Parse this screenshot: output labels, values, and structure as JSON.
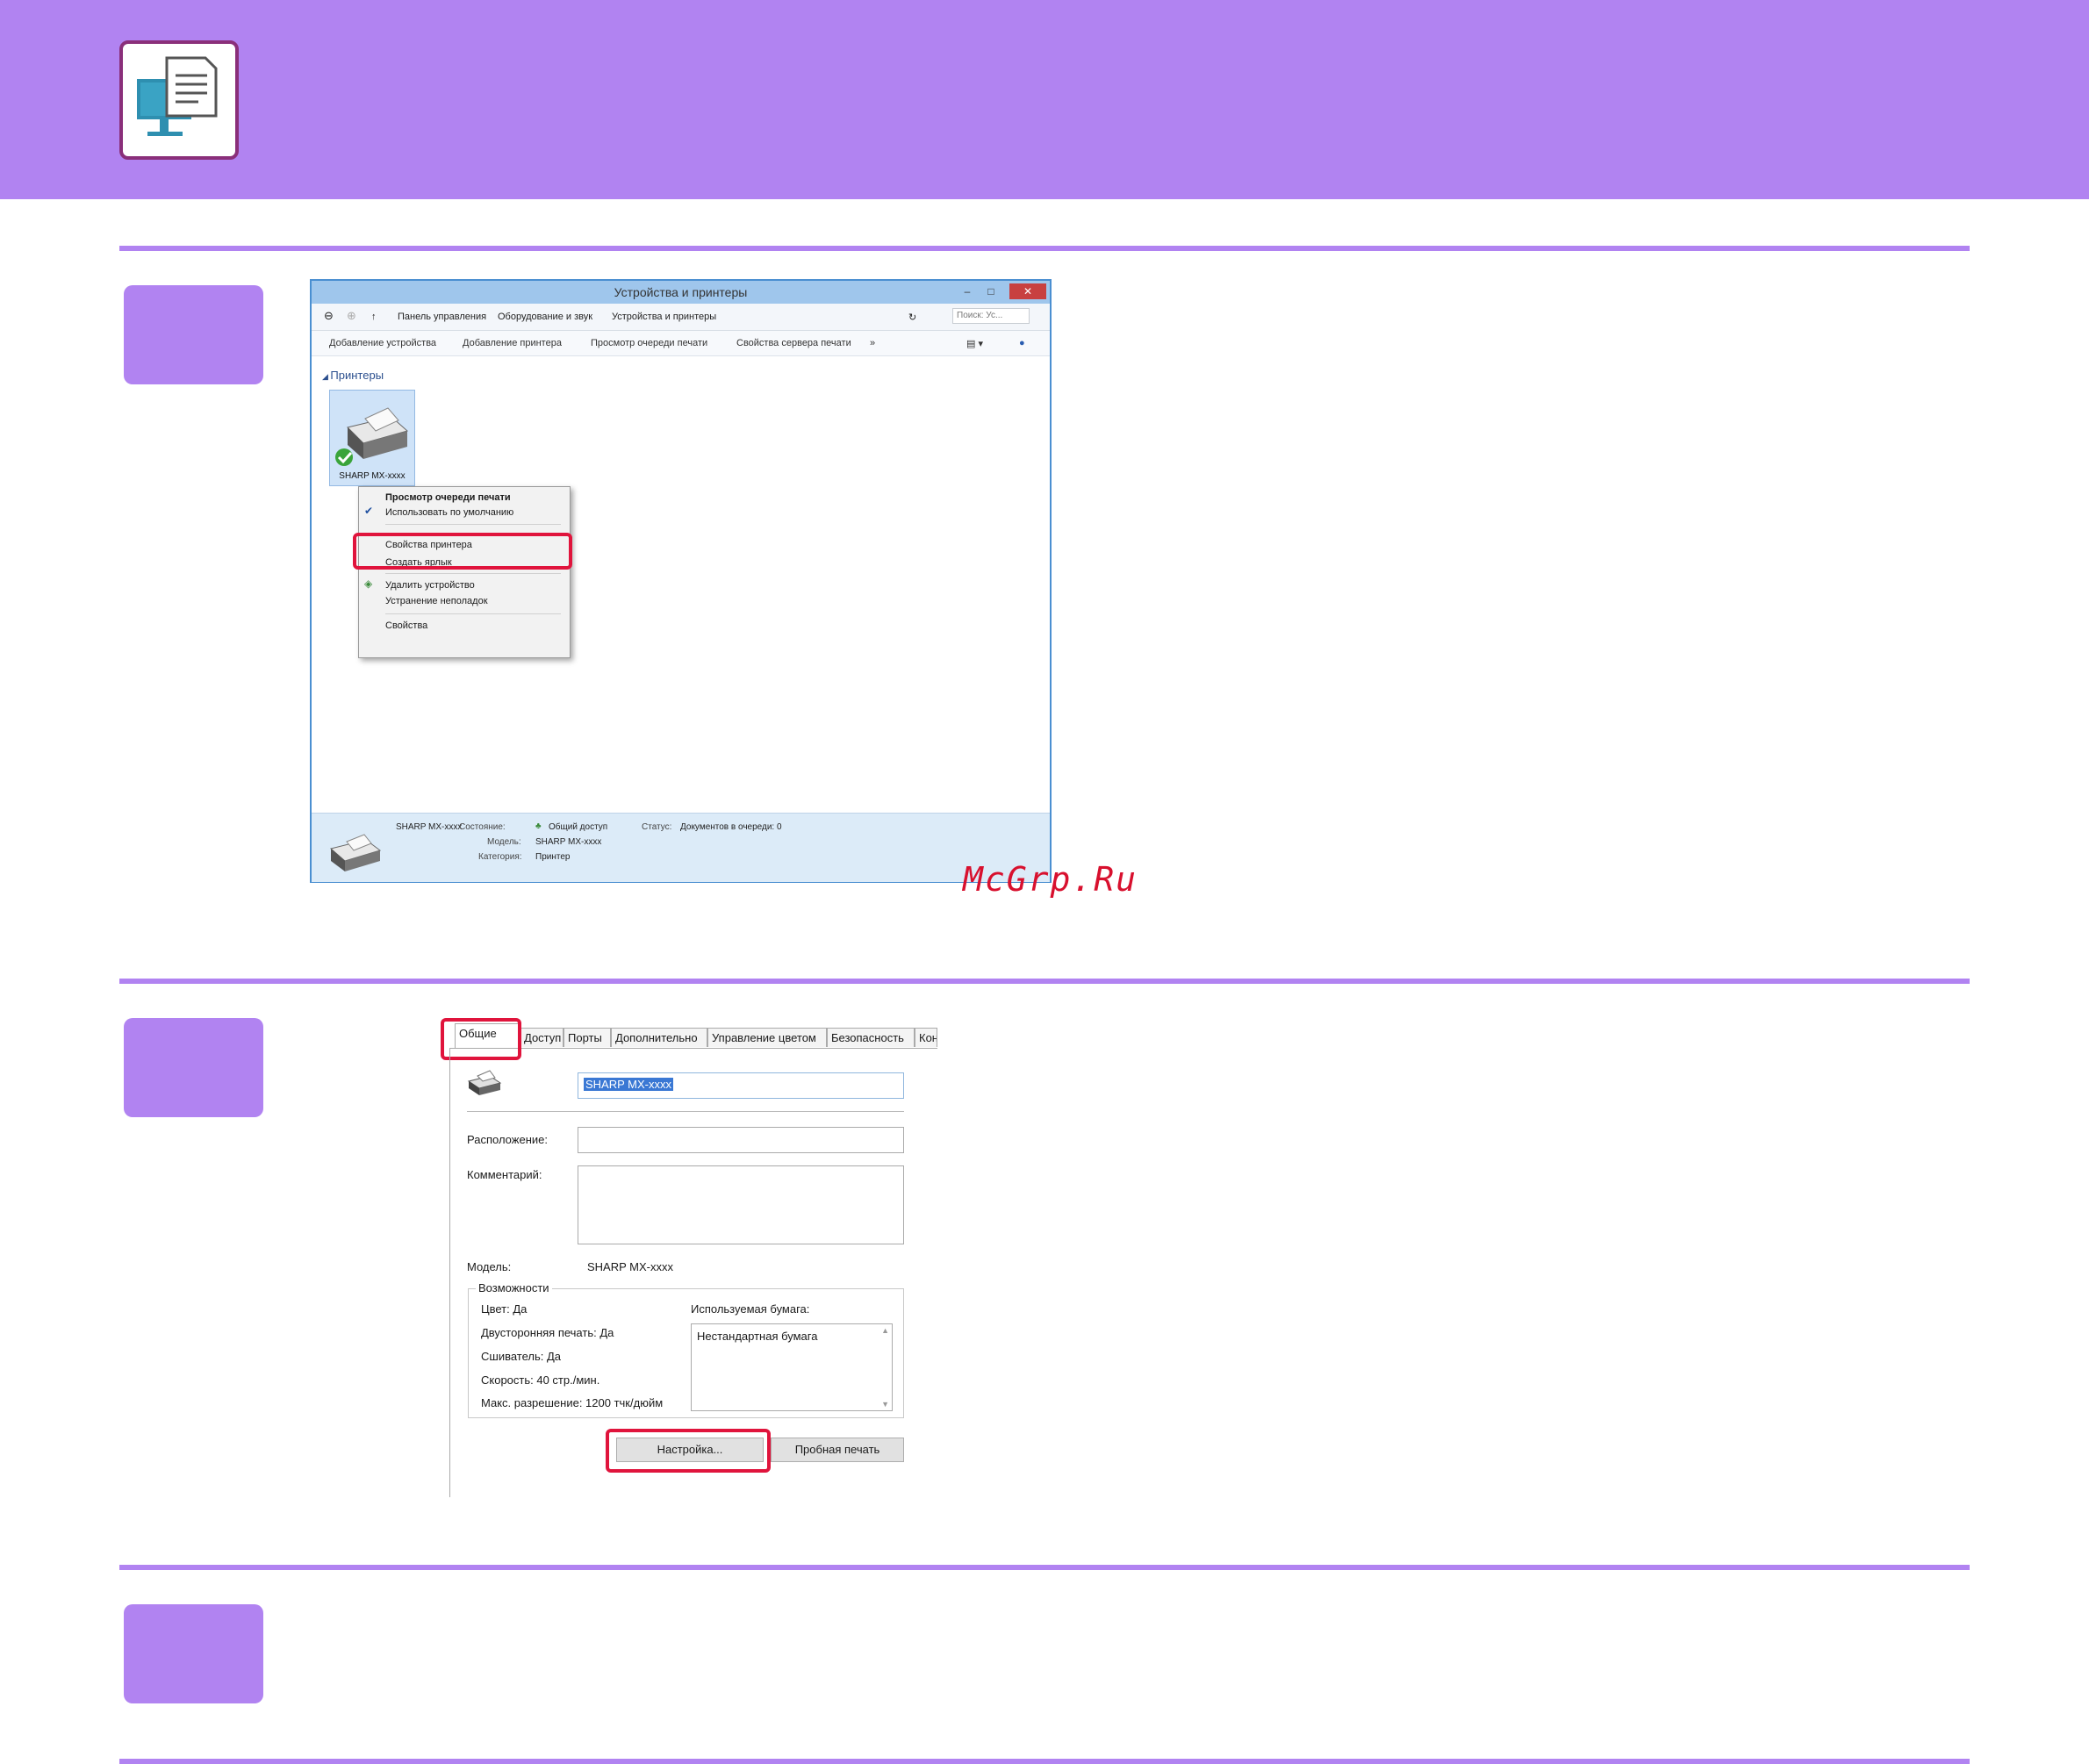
{
  "colors": {
    "accent": "#b183f1",
    "highlight": "#e0143c",
    "watermark": "#d8102e"
  },
  "header": {
    "icon": "pc-printer-icon"
  },
  "steps": [
    {
      "number": ""
    },
    {
      "number": ""
    },
    {
      "number": ""
    }
  ],
  "devices_window": {
    "title": "Устройства и принтеры",
    "breadcrumb": [
      "Панель управления",
      "Оборудование и звук",
      "Устройства и принтеры"
    ],
    "search_placeholder": "Поиск: Ус...",
    "toolbar": [
      "Добавление устройства",
      "Добавление принтера",
      "Просмотр очереди печати",
      "Свойства сервера печати",
      "»"
    ],
    "group_label": "Принтеры",
    "printer_name": "SHARP MX-xxxx",
    "context_menu": [
      {
        "label": "Просмотр очереди печати",
        "bold": true
      },
      {
        "label": "Использовать по умолчанию",
        "checked": true
      },
      {
        "label": "Свойства принтера",
        "highlighted": true
      },
      {
        "label": "Создать ярлык"
      },
      {
        "label": "Удалить устройство"
      },
      {
        "label": "Устранение неполадок"
      },
      {
        "label": "Свойства"
      }
    ],
    "status_bar": {
      "name": "SHARP MX-xxxx",
      "state_label": "Состояние:",
      "state_value": "Общий доступ",
      "status_label": "Статус:",
      "status_value": "Документов в очереди: 0",
      "model_label": "Модель:",
      "model_value": "SHARP MX-xxxx",
      "category_label": "Категория:",
      "category_value": "Принтер"
    }
  },
  "properties_dialog": {
    "tabs": [
      "Общие",
      "Доступ",
      "Порты",
      "Дополнительно",
      "Управление цветом",
      "Безопасность",
      "Конф"
    ],
    "printer_name_value": "SHARP MX-xxxx",
    "location_label": "Расположение:",
    "comment_label": "Комментарий:",
    "model_label": "Модель:",
    "model_value": "SHARP MX-xxxx",
    "features_title": "Возможности",
    "features": [
      "Цвет: Да",
      "Двусторонняя печать: Да",
      "Сшиватель: Да",
      "Скорость: 40 стр./мин.",
      "Макс. разрешение: 1200 тчк/дюйм"
    ],
    "paper_label": "Используемая бумага:",
    "paper_value": "Нестандартная бумага",
    "settings_button": "Настройка...",
    "test_print_button": "Пробная печать"
  },
  "watermark": "McGrp.Ru"
}
